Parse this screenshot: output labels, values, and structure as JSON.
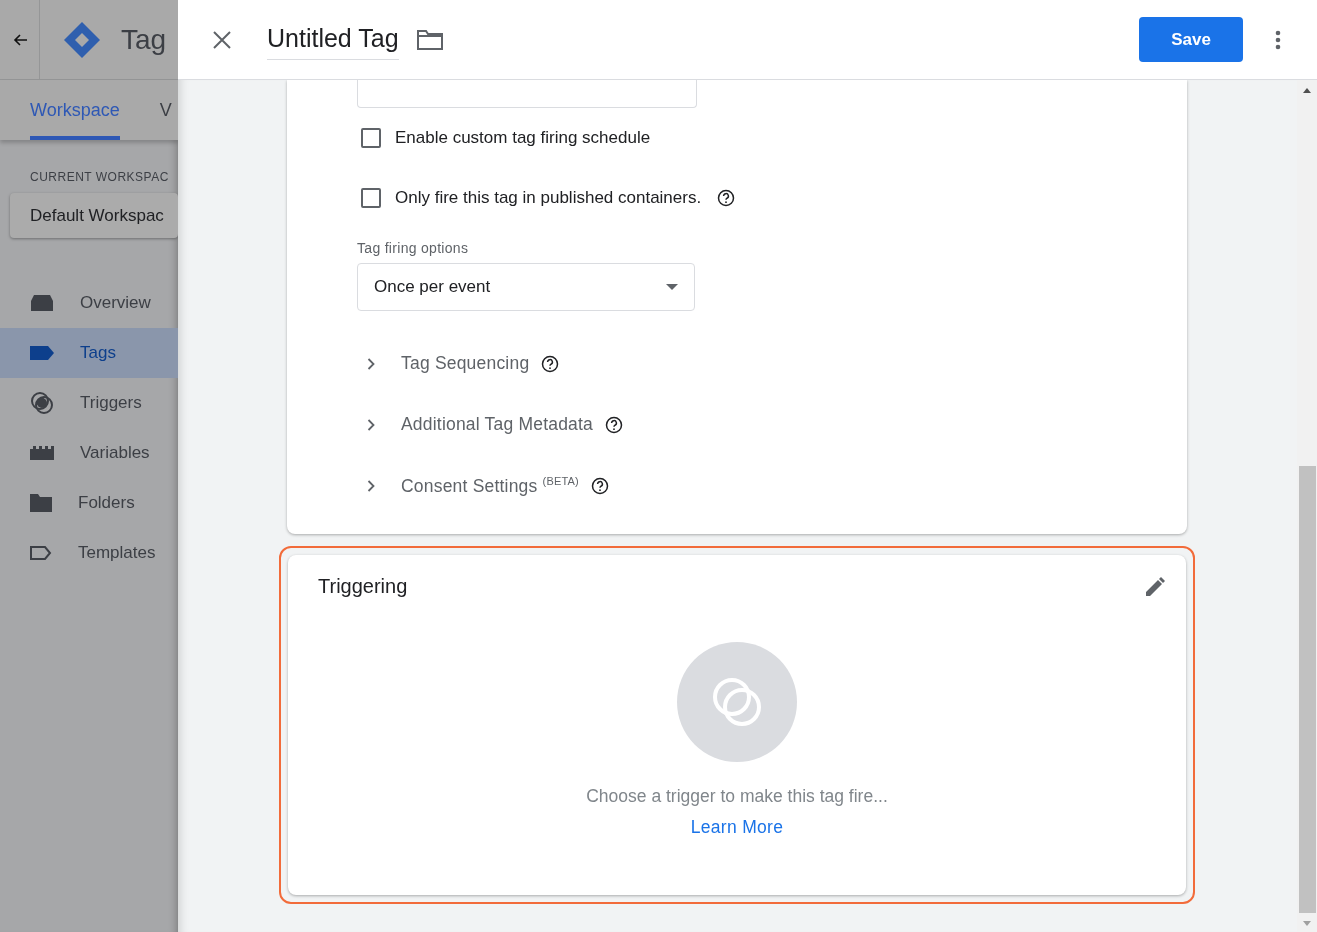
{
  "app": {
    "title": "Tag",
    "tabs": [
      {
        "label": "Workspace",
        "selected": true
      },
      {
        "label": "V",
        "selected": false
      }
    ],
    "workspace_label": "CURRENT WORKSPAC",
    "workspace": "Default Workspac",
    "nav": [
      {
        "label": "Overview",
        "kind": "overview",
        "selected": false
      },
      {
        "label": "Tags",
        "kind": "tag",
        "selected": true
      },
      {
        "label": "Triggers",
        "kind": "trigger",
        "selected": false
      },
      {
        "label": "Variables",
        "kind": "variable",
        "selected": false
      },
      {
        "label": "Folders",
        "kind": "folder",
        "selected": false
      },
      {
        "label": "Templates",
        "kind": "template",
        "selected": false
      }
    ]
  },
  "panel": {
    "title": "Untitled Tag",
    "save": "Save",
    "checkboxes": [
      {
        "label": "Enable custom tag firing schedule",
        "checked": false,
        "help": false
      },
      {
        "label": "Only fire this tag in published containers.",
        "checked": false,
        "help": true
      }
    ],
    "firing_options": {
      "label": "Tag firing options",
      "value": "Once per event"
    },
    "sections": [
      {
        "label": "Tag Sequencing",
        "expanded": false
      },
      {
        "label": "Additional Tag Metadata",
        "expanded": false
      },
      {
        "label": "Consent Settings $^{(BETA)}$",
        "expanded": false
      }
    ],
    "triggering": {
      "title": "Triggering",
      "highlighted": true,
      "message": "Choose a trigger to make this tag fire...",
      "link": "Learn More"
    }
  }
}
